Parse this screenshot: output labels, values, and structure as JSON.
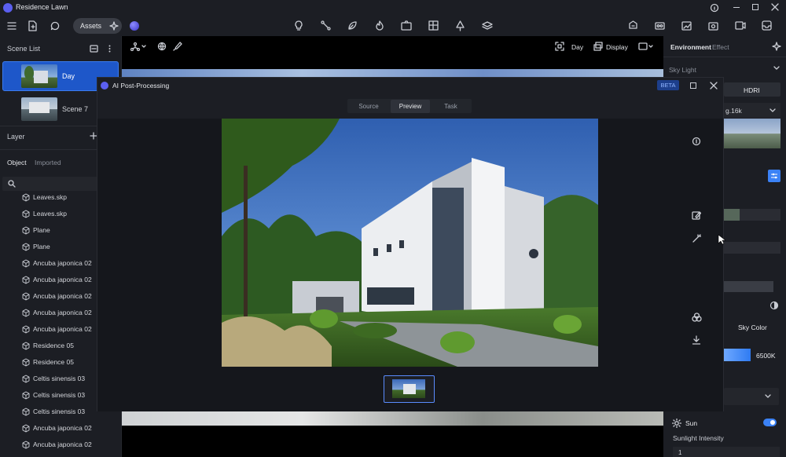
{
  "window": {
    "title": "Residence Lawn"
  },
  "toolbar": {
    "assets_label": "Assets"
  },
  "viewport_bar": {
    "preset_label": "Day",
    "display_label": "Display"
  },
  "left_panel": {
    "scene_list_title": "Scene List",
    "scenes": [
      {
        "label": "Day",
        "selected": true
      },
      {
        "label": "Scene 7",
        "selected": false
      }
    ],
    "layer_title": "Layer",
    "tabs": [
      "Object",
      "Imported"
    ],
    "objects": [
      "Leaves.skp",
      "Leaves.skp",
      "Plane",
      "Plane",
      "Ancuba japonica 02",
      "Ancuba japonica 02",
      "Ancuba japonica 02",
      "Ancuba japonica 02",
      "Ancuba japonica 02",
      "Residence 05",
      "Residence 05",
      "Celtis sinensis 03",
      "Celtis sinensis 03",
      "Celtis sinensis 03",
      "Ancuba japonica 02",
      "Ancuba japonica 02"
    ]
  },
  "right_panel": {
    "tabs": [
      "Environment",
      "Effect"
    ],
    "sky_light_label": "Sky Light",
    "hdri_label": "HDRI",
    "hdri_file": "g.16k",
    "sky_color_label": "Sky Color",
    "color_temp": "6500K",
    "sun_label": "Sun",
    "sunlight_intensity_label": "Sunlight Intensity",
    "sunlight_value": "1"
  },
  "modal": {
    "title": "AI Post-Processing",
    "badge": "BETA",
    "tabs": [
      "Source",
      "Preview",
      "Task"
    ],
    "active_tab": "Preview"
  },
  "colors": {
    "accent": "#3b82f6",
    "brand": "#5b5ff0",
    "panel": "#1c1e24"
  }
}
